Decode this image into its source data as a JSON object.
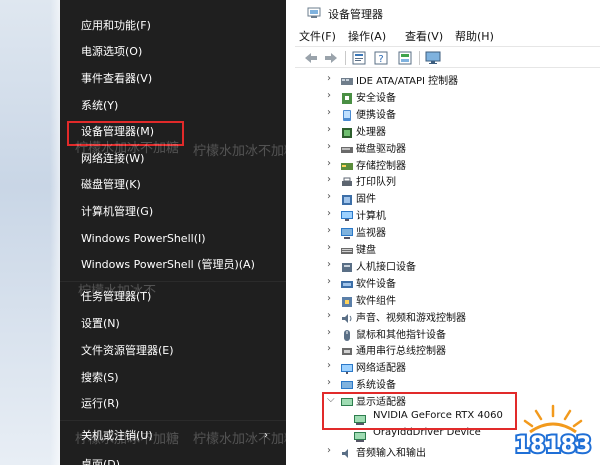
{
  "winx_menu": {
    "items": [
      {
        "label": "应用和功能(F)",
        "has_sub": false
      },
      {
        "label": "电源选项(O)",
        "has_sub": false
      },
      {
        "label": "事件查看器(V)",
        "has_sub": false
      },
      {
        "label": "系统(Y)",
        "has_sub": false
      },
      {
        "label": "设备管理器(M)",
        "has_sub": false
      },
      {
        "label": "网络连接(W)",
        "has_sub": false
      },
      {
        "label": "磁盘管理(K)",
        "has_sub": false
      },
      {
        "label": "计算机管理(G)",
        "has_sub": false
      },
      {
        "label": "Windows PowerShell(I)",
        "has_sub": false
      },
      {
        "label": "Windows PowerShell (管理员)(A)",
        "has_sub": false
      },
      {
        "label": "任务管理器(T)",
        "has_sub": false
      },
      {
        "label": "设置(N)",
        "has_sub": false
      },
      {
        "label": "文件资源管理器(E)",
        "has_sub": false
      },
      {
        "label": "搜索(S)",
        "has_sub": false
      },
      {
        "label": "运行(R)",
        "has_sub": false
      },
      {
        "label": "关机或注销(U)",
        "has_sub": true
      },
      {
        "label": "桌面(D)",
        "has_sub": false
      }
    ],
    "highlighted_index": 4
  },
  "device_manager": {
    "title": "设备管理器",
    "menu": [
      "文件(F)",
      "操作(A)",
      "查看(V)",
      "帮助(H)"
    ],
    "toolbar_icons": [
      "back-arrow-icon",
      "forward-arrow-icon",
      "properties-icon",
      "help-icon",
      "update-driver-icon",
      "monitor-scan-icon"
    ],
    "tree": [
      {
        "label": "IDE ATA/ATAPI 控制器",
        "icon": "ide-controller-icon",
        "expanded": false
      },
      {
        "label": "安全设备",
        "icon": "security-device-icon",
        "expanded": false
      },
      {
        "label": "便携设备",
        "icon": "portable-device-icon",
        "expanded": false
      },
      {
        "label": "处理器",
        "icon": "processor-icon",
        "expanded": false
      },
      {
        "label": "磁盘驱动器",
        "icon": "disk-drive-icon",
        "expanded": false
      },
      {
        "label": "存储控制器",
        "icon": "storage-controller-icon",
        "expanded": false
      },
      {
        "label": "打印队列",
        "icon": "print-queue-icon",
        "expanded": false
      },
      {
        "label": "固件",
        "icon": "firmware-icon",
        "expanded": false
      },
      {
        "label": "计算机",
        "icon": "computer-icon",
        "expanded": false
      },
      {
        "label": "监视器",
        "icon": "monitor-icon",
        "expanded": false
      },
      {
        "label": "键盘",
        "icon": "keyboard-icon",
        "expanded": false
      },
      {
        "label": "人机接口设备",
        "icon": "hid-icon",
        "expanded": false
      },
      {
        "label": "软件设备",
        "icon": "software-device-icon",
        "expanded": false
      },
      {
        "label": "软件组件",
        "icon": "software-component-icon",
        "expanded": false
      },
      {
        "label": "声音、视频和游戏控制器",
        "icon": "sound-icon",
        "expanded": false
      },
      {
        "label": "鼠标和其他指针设备",
        "icon": "mouse-icon",
        "expanded": false
      },
      {
        "label": "通用串行总线控制器",
        "icon": "usb-icon",
        "expanded": false
      },
      {
        "label": "网络适配器",
        "icon": "network-adapter-icon",
        "expanded": false
      },
      {
        "label": "系统设备",
        "icon": "system-device-icon",
        "expanded": false
      },
      {
        "label": "显示适配器",
        "icon": "display-adapter-icon",
        "expanded": true,
        "children": [
          {
            "label": "NVIDIA GeForce RTX 4060",
            "icon": "gpu-icon"
          },
          {
            "label": "OrayIddDriver Device",
            "icon": "gpu-icon"
          }
        ]
      },
      {
        "label": "音频输入和输出",
        "icon": "audio-io-icon",
        "expanded": false
      }
    ]
  },
  "watermarks": {
    "text_1": "柠檬水加冰不加糖",
    "text_2": "柠檬水加冰不加糖",
    "text_3": "柠檬水加冰不",
    "text_4": "柠檬水加冰不加糖",
    "text_5": "柠檬水加冰不加糖"
  },
  "logo": {
    "text": "18183"
  },
  "colors": {
    "highlight_red": "#e12a2a",
    "menu_bg": "#1f1f1f",
    "logo_orange": "#f29a1d",
    "logo_blue": "#1f6fd6"
  }
}
